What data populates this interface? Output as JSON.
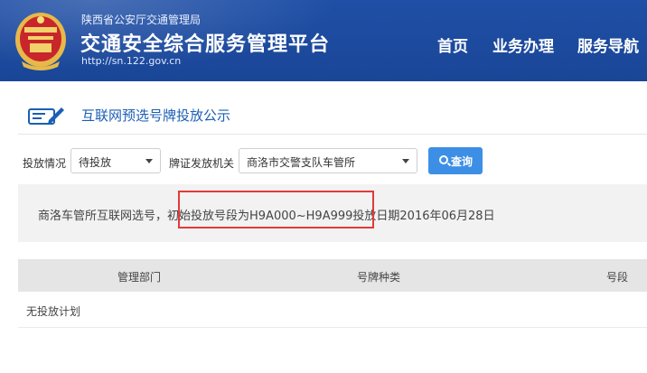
{
  "header": {
    "org_name": "陕西省公安厅交通管理局",
    "site_title": "交通安全综合服务管理平台",
    "site_url": "http://sn.122.gov.cn",
    "nav": [
      "首页",
      "业务办理",
      "服务导航"
    ]
  },
  "panel": {
    "title": "互联网预选号牌投放公示"
  },
  "filters": {
    "status_label": "投放情况",
    "status_value": "待投放",
    "authority_label": "牌证发放机关",
    "authority_value": "商洛市交警支队车管所",
    "query_label": "查询"
  },
  "notice": {
    "text": "商洛车管所互联网选号，初始投放号段为H9A000~H9A999投放日期2016年06月28日"
  },
  "table": {
    "headers": [
      "管理部门",
      "号牌种类",
      "号段"
    ],
    "empty_text": "无投放计划"
  },
  "colors": {
    "header_bg": "#1f4fa6",
    "title_blue": "#1b5fb4",
    "button_blue": "#3d8fe6",
    "highlight_red": "#e23a3a"
  }
}
